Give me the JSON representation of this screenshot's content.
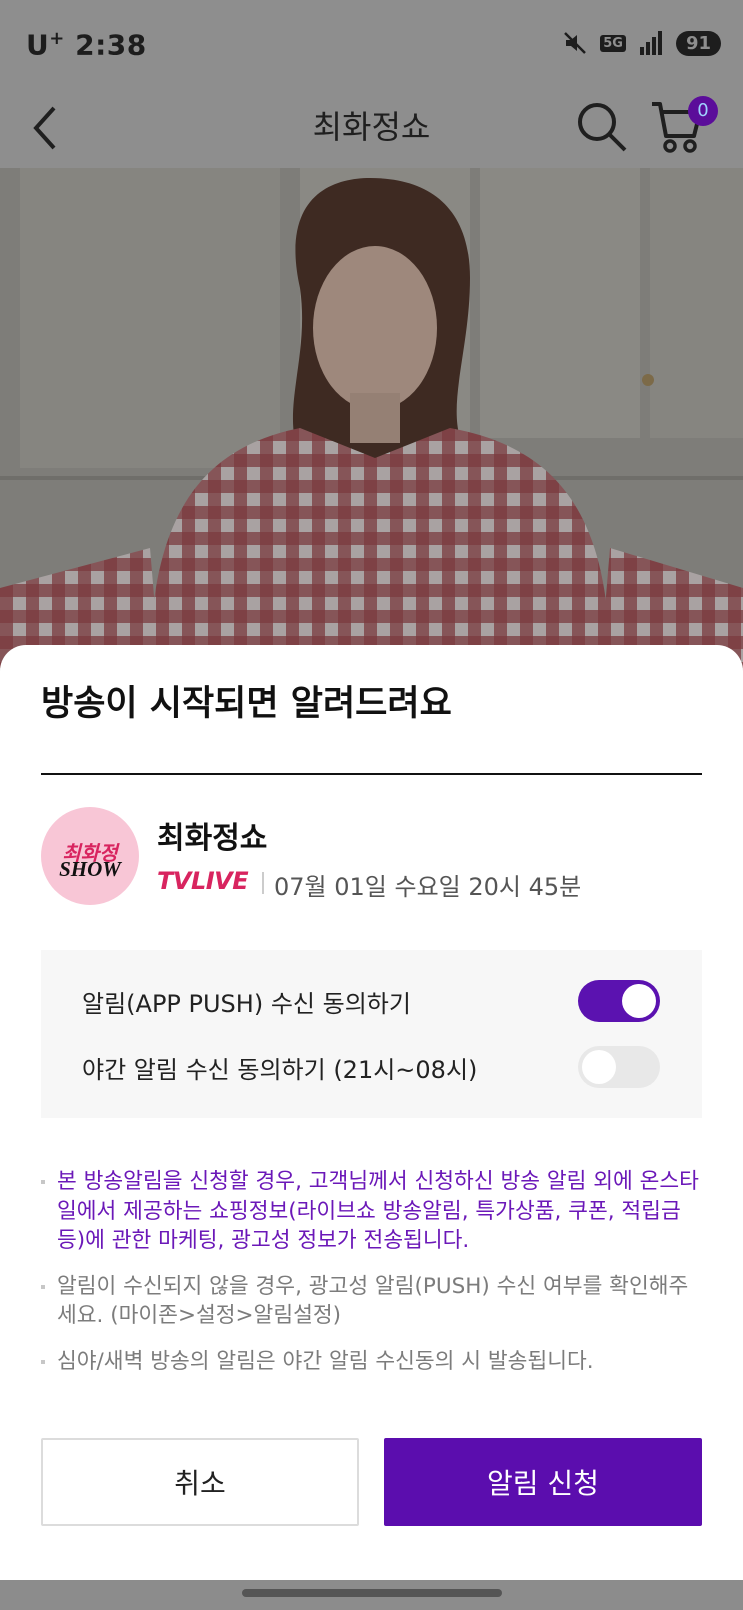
{
  "status_bar": {
    "carrier": "U",
    "carrier_sup": "+",
    "time": "2:38",
    "network": "5G",
    "battery": "91"
  },
  "header": {
    "title": "최화정쇼",
    "cart_count": "0"
  },
  "sheet": {
    "title": "방송이 시작되면 알려드려요",
    "logo": {
      "line1": "최화정",
      "line2": "SHOW"
    },
    "show_name": "최화정쇼",
    "live_label": "TVLIVE",
    "schedule": "07월 01일 수요일 20시 45분",
    "options": [
      {
        "label": "알림(APP PUSH) 수신 동의하기",
        "on": true
      },
      {
        "label": "야간 알림 수신 동의하기 (21시~08시)",
        "on": false
      }
    ],
    "notes": [
      "본 방송알림을 신청할 경우, 고객님께서 신청하신 방송 알림 외에 온스타일에서 제공하는 쇼핑정보(라이브쇼 방송알림, 특가상품, 쿠폰, 적립금 등)에 관한 마케팅, 광고성 정보가 전송됩니다.",
      "알림이 수신되지 않을 경우, 광고성 알림(PUSH) 수신 여부를 확인해주세요. (마이존>설정>알림설정)",
      "심야/새벽 방송의 알림은 야간 알림 수신동의 시 발송됩니다."
    ],
    "cancel_label": "취소",
    "apply_label": "알림 신청"
  },
  "colors": {
    "accent": "#5b0dae",
    "live": "#d8245f",
    "toggle_on": "#5b12b0"
  }
}
